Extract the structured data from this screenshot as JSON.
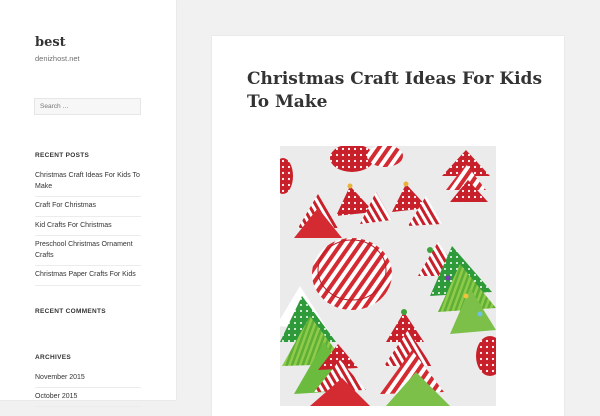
{
  "site": {
    "title": "best",
    "description": "denizhost.net"
  },
  "search": {
    "placeholder": "Search …"
  },
  "widgets": {
    "recent_posts_title": "RECENT POSTS",
    "recent_comments_title": "RECENT COMMENTS",
    "archives_title": "ARCHIVES"
  },
  "recent_posts": [
    "Christmas Craft Ideas For Kids To Make",
    "Craft For Christmas",
    "Kid Crafts For Christmas",
    "Preschool Christmas Ornament Crafts",
    "Christmas Paper Crafts For Kids"
  ],
  "archives": [
    "November 2015",
    "October 2015"
  ],
  "post": {
    "title": "Christmas Craft Ideas For Kids To Make",
    "image_subject": "paper cupcake-liner christmas trees craft"
  },
  "colors": {
    "page_bg": "#f1f1f1",
    "card_bg": "#ffffff",
    "text": "#333333",
    "muted": "#707070"
  }
}
